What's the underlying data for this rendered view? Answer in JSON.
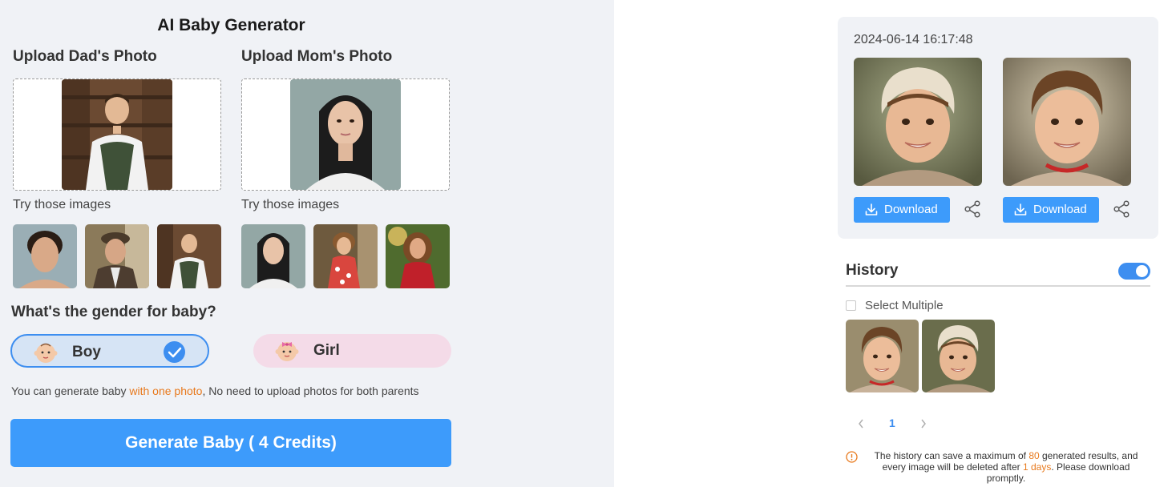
{
  "generator": {
    "title": "AI Baby Generator",
    "dad_heading": "Upload Dad's Photo",
    "mom_heading": "Upload Mom's Photo",
    "try_label": "Try those images",
    "gender_question": "What's the gender for baby?",
    "gender_options": [
      {
        "label": "Boy",
        "selected": true
      },
      {
        "label": "Girl",
        "selected": false
      }
    ],
    "hint_prefix": "You can generate baby ",
    "hint_accent": "with one photo",
    "hint_suffix": ", No need to upload photos for both parents",
    "generate_label": "Generate Baby ( 4 Credits)"
  },
  "result": {
    "timestamp": "2024-06-14 16:17:48",
    "download_label": "Download"
  },
  "history": {
    "title": "History",
    "toggle_on": true,
    "select_multiple": "Select Multiple",
    "current_page": "1",
    "prev_icon": "chevron-left-icon",
    "next_icon": "chevron-right-icon",
    "notice_part1": "The history can save a maximum of ",
    "notice_max": "80",
    "notice_part2": " generated results, and every image will be deleted after ",
    "notice_days": "1 days",
    "notice_part3": ". Please download promptly."
  },
  "colors": {
    "accent_blue": "#3d9bfb",
    "accent_orange": "#e87a1e",
    "panel_bg": "#f0f2f6",
    "boy_bg": "#d6e4f5",
    "girl_bg": "#f4dbe8"
  }
}
